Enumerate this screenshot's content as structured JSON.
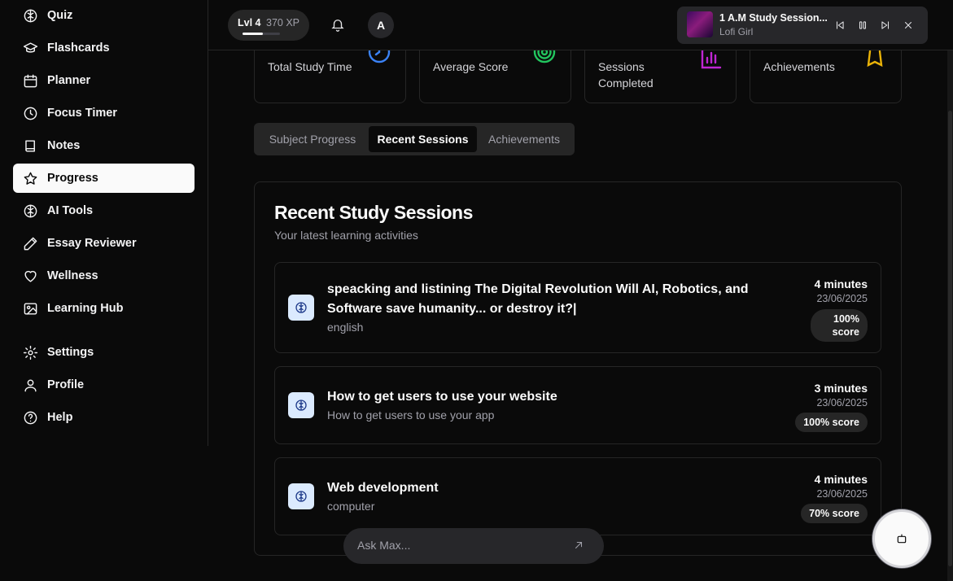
{
  "sidebar": {
    "items": [
      {
        "label": "Quiz",
        "icon": "brain-icon"
      },
      {
        "label": "Flashcards",
        "icon": "graduation-cap-icon"
      },
      {
        "label": "Planner",
        "icon": "calendar-icon"
      },
      {
        "label": "Focus Timer",
        "icon": "clock-icon"
      },
      {
        "label": "Notes",
        "icon": "book-icon"
      },
      {
        "label": "Progress",
        "icon": "star-icon",
        "active": true
      },
      {
        "label": "AI Tools",
        "icon": "brain-icon"
      },
      {
        "label": "Essay Reviewer",
        "icon": "pen-icon"
      },
      {
        "label": "Wellness",
        "icon": "heart-icon"
      },
      {
        "label": "Learning Hub",
        "icon": "image-icon"
      },
      {
        "label": "Settings",
        "icon": "gear-icon"
      },
      {
        "label": "Profile",
        "icon": "user-icon"
      },
      {
        "label": "Help",
        "icon": "help-circle-icon"
      }
    ]
  },
  "header": {
    "level": "Lvl 4",
    "xp": "370 XP",
    "xp_progress": 0.55,
    "avatar_initial": "A"
  },
  "player": {
    "title": "1 A.M Study Session...",
    "artist": "Lofi Girl"
  },
  "stats": [
    {
      "label": "Total Study Time",
      "icon": "clock-icon",
      "color": "#3b82f6"
    },
    {
      "label": "Average Score",
      "icon": "target-icon",
      "color": "#22c55e"
    },
    {
      "label": "Sessions\nCompleted",
      "icon": "bar-chart-icon",
      "color": "#c026d3"
    },
    {
      "label": "Achievements",
      "icon": "award-icon",
      "color": "#eab308"
    }
  ],
  "tabs": [
    {
      "label": "Subject Progress"
    },
    {
      "label": "Recent Sessions",
      "active": true
    },
    {
      "label": "Achievements"
    }
  ],
  "sessions_card": {
    "title": "Recent Study Sessions",
    "subtitle": "Your latest learning activities",
    "sessions": [
      {
        "title": "speacking and listining The Digital Revolution Will AI, Robotics, and Software save humanity... or destroy it?|",
        "subject": "english",
        "duration": "4 minutes",
        "date": "23/06/2025",
        "score": "100% score"
      },
      {
        "title": "How to get users to use your website",
        "subject": "How to get users to use your app",
        "duration": "3 minutes",
        "date": "23/06/2025",
        "score": "100% score"
      },
      {
        "title": "Web development",
        "subject": "computer",
        "duration": "4 minutes",
        "date": "23/06/2025",
        "score": "70% score"
      }
    ]
  },
  "ask": {
    "placeholder": "Ask Max..."
  },
  "colors": {
    "background": "#0a0a0a",
    "card_border": "#262626",
    "accent": "#fafafa"
  }
}
